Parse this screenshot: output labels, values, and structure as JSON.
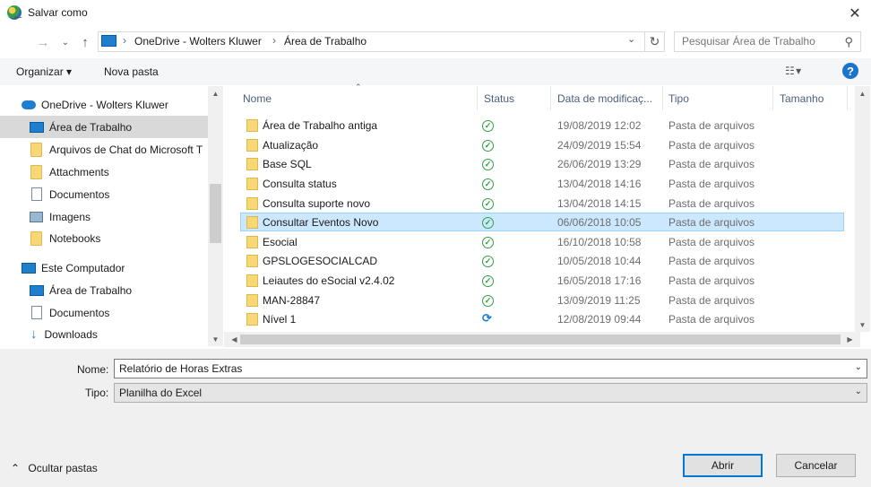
{
  "window": {
    "title": "Salvar como"
  },
  "address": {
    "crumbs": [
      "OneDrive - Wolters Kluwer",
      "Área de Trabalho"
    ],
    "search_placeholder": "Pesquisar Área de Trabalho"
  },
  "toolbar": {
    "organize": "Organizar ▾",
    "new_folder": "Nova pasta"
  },
  "nav": {
    "items": [
      {
        "label": "OneDrive - Wolters Kluwer",
        "icon": "cloud-icon"
      },
      {
        "label": "Área de Trabalho",
        "icon": "desktop-icon"
      },
      {
        "label": "Arquivos de Chat do Microsoft T",
        "icon": "folder-icon"
      },
      {
        "label": "Attachments",
        "icon": "folder-icon"
      },
      {
        "label": "Documentos",
        "icon": "documents-icon"
      },
      {
        "label": "Imagens",
        "icon": "pictures-icon"
      },
      {
        "label": "Notebooks",
        "icon": "folder-icon"
      },
      {
        "label": "Este Computador",
        "icon": "computer-icon"
      },
      {
        "label": "Área de Trabalho",
        "icon": "desktop-icon"
      },
      {
        "label": "Documentos",
        "icon": "documents-icon"
      },
      {
        "label": "Downloads",
        "icon": "downloads-icon"
      }
    ]
  },
  "columns": {
    "name": "Nome",
    "status": "Status",
    "date": "Data de modificaç...",
    "type": "Tipo",
    "size": "Tamanho"
  },
  "files": [
    {
      "name": "Área de Trabalho antiga",
      "status": "ok",
      "date": "19/08/2019 12:02",
      "type": "Pasta de arquivos"
    },
    {
      "name": "Atualização",
      "status": "ok",
      "date": "24/09/2019 15:54",
      "type": "Pasta de arquivos"
    },
    {
      "name": "Base SQL",
      "status": "ok",
      "date": "26/06/2019 13:29",
      "type": "Pasta de arquivos"
    },
    {
      "name": "Consulta status",
      "status": "ok",
      "date": "13/04/2018 14:16",
      "type": "Pasta de arquivos"
    },
    {
      "name": "Consulta suporte novo",
      "status": "ok",
      "date": "13/04/2018 14:15",
      "type": "Pasta de arquivos"
    },
    {
      "name": "Consultar Eventos Novo",
      "status": "ok",
      "date": "06/06/2018 10:05",
      "type": "Pasta de arquivos"
    },
    {
      "name": "Esocial",
      "status": "ok",
      "date": "16/10/2018 10:58",
      "type": "Pasta de arquivos"
    },
    {
      "name": "GPSLOGESOCIALCAD",
      "status": "ok",
      "date": "10/05/2018 10:44",
      "type": "Pasta de arquivos"
    },
    {
      "name": "Leiautes do eSocial v2.4.02",
      "status": "ok",
      "date": "16/05/2018 17:16",
      "type": "Pasta de arquivos"
    },
    {
      "name": "MAN-28847",
      "status": "ok",
      "date": "13/09/2019 11:25",
      "type": "Pasta de arquivos"
    },
    {
      "name": "Nível 1",
      "status": "sync",
      "date": "12/08/2019 09:44",
      "type": "Pasta de arquivos"
    }
  ],
  "form": {
    "name_label": "Nome:",
    "name_value": "Relatório de Horas Extras",
    "type_label": "Tipo:",
    "type_value": "Planilha do Excel"
  },
  "footer": {
    "hide_folders": "Ocultar pastas",
    "save": "Abrir",
    "cancel": "Cancelar"
  }
}
